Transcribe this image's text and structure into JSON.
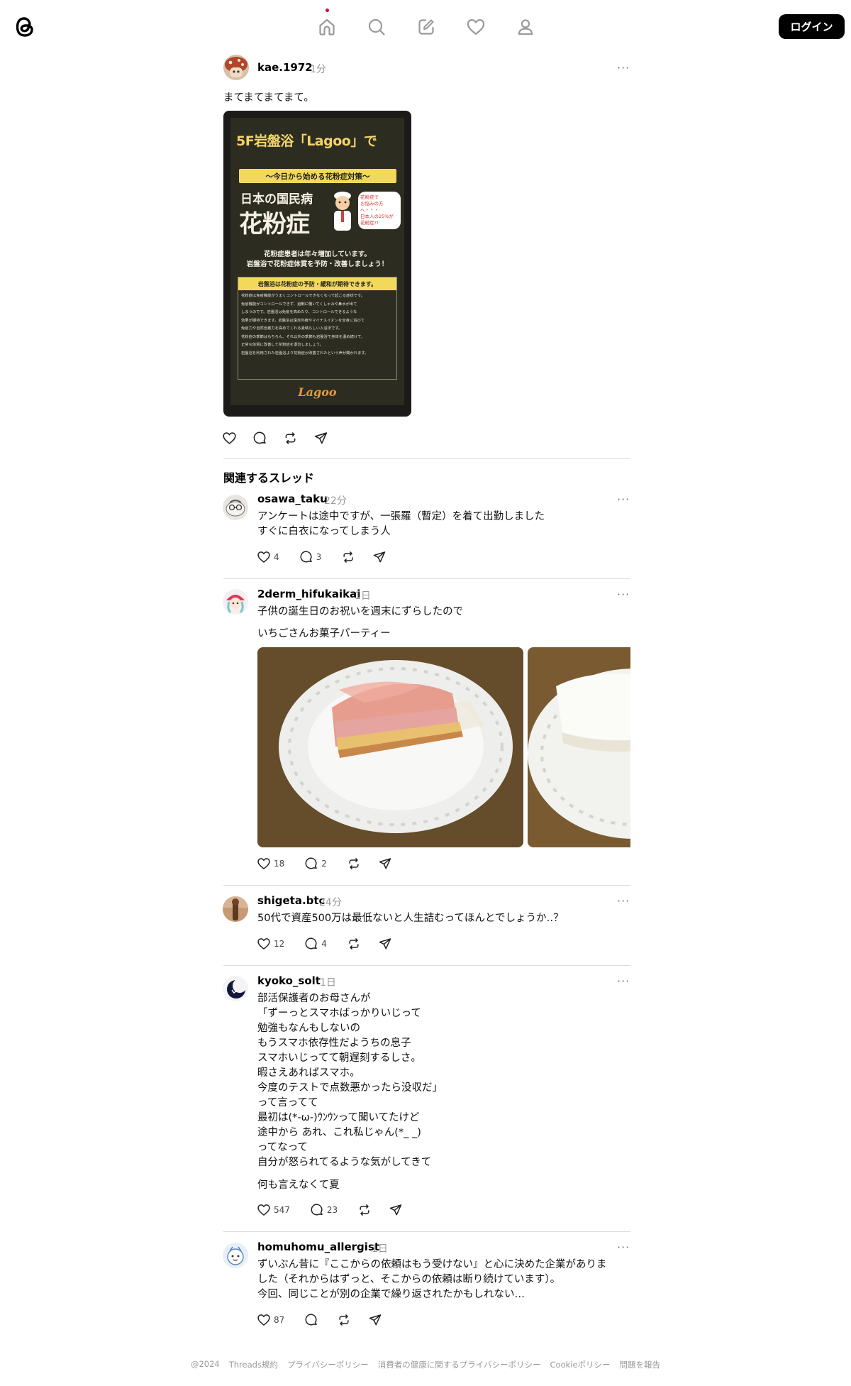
{
  "nav": {
    "items": [
      "home-icon",
      "search-icon",
      "compose-icon",
      "heart-icon",
      "profile-icon"
    ],
    "login_label": "ログイン"
  },
  "main_post": {
    "username": "kae.1972",
    "time": "1分",
    "text": "まてまてまてまて。",
    "poster": {
      "header": "5F岩盤浴「Lagoo」で",
      "band": "〜今日から始める花粉症対策〜",
      "headline1": "日本の国民病",
      "headline2": "花粉症",
      "bubble": "花粉症で\nお悩みの方へ・・・\n日本人の25%が\n花粉症?!",
      "sub1": "花粉症患者は年々増加しています。",
      "sub2": "岩盤浴で花粉症体質を予防・改善しましょう！",
      "box_title": "岩盤浴は花粉症の予防・緩和が期待できます。",
      "body": "花粉症は免疫機能がうまくコントロールできなくなって起こる症状です。\n免疫機能がコントロールできず、過剰に働いてくしゃみや鼻水が出て\nしまうのです。岩盤浴は免疫を高めたり、コントロールできるような\n効果が期待できます。岩盤浴は遠赤外線やマイナスイオンを全身に浴びて\n免疫力や自然治癒力を高めてくれる素晴らしい入浴法です。\n花粉症の季節はもちろん、それ以外の季節も岩盤浴で身体を温め続けて、\n正常な体質に改善して花粉症を退治しましょう。\n岩盤浴を利用された岩盤浴より花粉症が改善されたという声が聞かれます。",
      "footer_logo": "Lagoo"
    }
  },
  "related_title": "関連するスレッド",
  "threads": [
    {
      "username": "osawa_taku",
      "time": "22分",
      "text": "アンケートは途中ですが、一張羅（暫定）を着て出勤しました\nすぐに白衣になってしまう人",
      "likes": "4",
      "replies": "3"
    },
    {
      "username": "2derm_hifukaikai",
      "time": "1日",
      "text": "子供の誕生日のお祝いを週末にずらしたので",
      "text2": "いちごさんお菓子パーティー",
      "likes": "18",
      "replies": "2"
    },
    {
      "username": "shigeta.btc",
      "time": "24分",
      "text": "50代で資産500万は最低ないと人生詰むってほんとでしょうか‥？",
      "likes": "12",
      "replies": "4"
    },
    {
      "username": "kyoko_solt",
      "time": "1日",
      "text": "部活保護者のお母さんが\n「ずーっとスマホばっかりいじって\n勉強もなんもしないの\nもうスマホ依存性だようちの息子\nスマホいじってて朝遅刻するしさ。\n暇さえあればスマホ。\n今度のテストで点数悪かったら没収だ」\nって言ってて\n最初は(*-ω-)ｳﾝｳﾝって聞いてたけど\n途中から あれ、これ私じゃん(*_ _)\nってなって\n自分が怒られてるような気がしてきて",
      "text2": "何も言えなくて夏",
      "likes": "547",
      "replies": "23"
    },
    {
      "username": "homuhomu_allergist",
      "time": "1日",
      "text": "ずいぶん昔に『ここからの依頼はもう受けない』と心に決めた企業がありま\nした（それからはずっと、そこからの依頼は断り続けています）。\n今回、同じことが別の企業で繰り返されたかもしれない…",
      "likes": "87",
      "replies": ""
    }
  ],
  "more_label": "···",
  "footer": [
    "@2024",
    "Threads規約",
    "プライバシーポリシー",
    "消費者の健康に関するプライバシーポリシー",
    "Cookieポリシー",
    "問題を報告"
  ]
}
